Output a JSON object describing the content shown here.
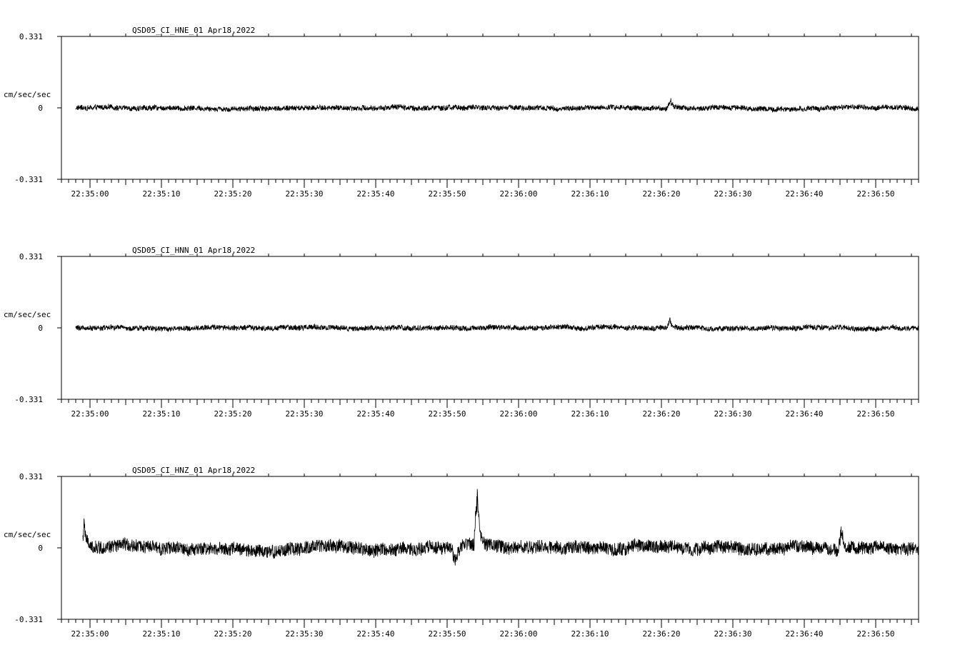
{
  "chart_data": [
    {
      "type": "line",
      "title": "QSD05_CI_HNE_01  Apr18,2022",
      "ylabel": "cm/sec/sec",
      "ylim": [
        -0.331,
        0.331
      ],
      "ytick_labels": [
        "0.331",
        "0",
        "-0.331"
      ],
      "xlim": [
        "22:34:56",
        "22:36:56"
      ],
      "xtick_labels": [
        "22:35:00",
        "22:35:10",
        "22:35:20",
        "22:35:30",
        "22:35:40",
        "22:35:50",
        "22:36:00",
        "22:36:10",
        "22:36:20",
        "22:36:30",
        "22:36:40",
        "22:36:50"
      ],
      "grid": false,
      "series_color": "#000000",
      "trace_start": "22:34:58",
      "noise_amplitude": 0.012,
      "events": [
        {
          "time": "22:36:21",
          "amplitude": 0.05
        }
      ]
    },
    {
      "type": "line",
      "title": "QSD05_CI_HNN_01  Apr18,2022",
      "ylabel": "cm/sec/sec",
      "ylim": [
        -0.331,
        0.331
      ],
      "ytick_labels": [
        "0.331",
        "0",
        "-0.331"
      ],
      "xlim": [
        "22:34:56",
        "22:36:56"
      ],
      "xtick_labels": [
        "22:35:00",
        "22:35:10",
        "22:35:20",
        "22:35:30",
        "22:35:40",
        "22:35:50",
        "22:36:00",
        "22:36:10",
        "22:36:20",
        "22:36:30",
        "22:36:40",
        "22:36:50"
      ],
      "grid": false,
      "series_color": "#000000",
      "trace_start": "22:34:58",
      "noise_amplitude": 0.012,
      "events": [
        {
          "time": "22:36:21",
          "amplitude": 0.04
        }
      ]
    },
    {
      "type": "line",
      "title": "QSD05_CI_HNZ_01  Apr18,2022",
      "ylabel": "cm/sec/sec",
      "ylim": [
        -0.331,
        0.331
      ],
      "ytick_labels": [
        "0.331",
        "0",
        "-0.331"
      ],
      "xlim": [
        "22:34:56",
        "22:36:56"
      ],
      "xtick_labels": [
        "22:35:00",
        "22:35:10",
        "22:35:20",
        "22:35:30",
        "22:35:40",
        "22:35:50",
        "22:36:00",
        "22:36:10",
        "22:36:20",
        "22:36:30",
        "22:36:40",
        "22:36:50"
      ],
      "grid": false,
      "series_color": "#000000",
      "trace_start": "22:34:59",
      "noise_amplitude": 0.03,
      "events": [
        {
          "time": "22:34:59",
          "amplitude": 0.13
        },
        {
          "time": "22:35:51",
          "amplitude": -0.09
        },
        {
          "time": "22:35:54",
          "amplitude": 0.3
        },
        {
          "time": "22:36:45",
          "amplitude": 0.12
        }
      ]
    }
  ]
}
